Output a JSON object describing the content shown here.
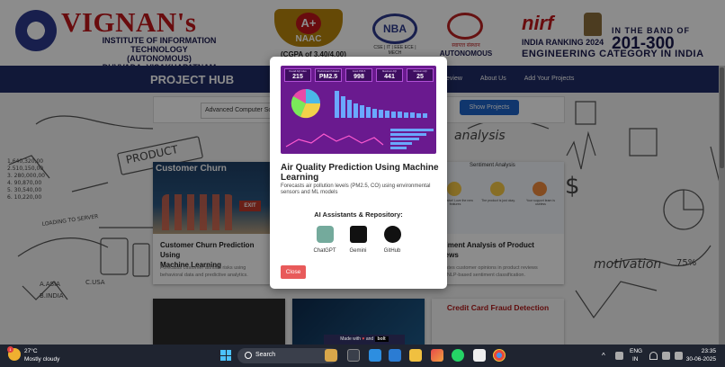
{
  "banner": {
    "institute_name": "VIGNAN's",
    "institute_sub1": "INSTITUTE OF INFORMATION TECHNOLOGY",
    "institute_sub2": "(AUTONOMOUS)",
    "institute_sub3": "DUVVADA, VISAKHAPATNAM",
    "naac_grade": "A+",
    "naac_label": "NAAC",
    "cgpa": "(CGPA of 3.40/4.00)",
    "nba_label": "NBA",
    "nba_sub": "CSE | IT | EEE ECE | MECH",
    "ugc_sub": "स्वायत्त संस्थान",
    "autonomous": "AUTONOMOUS",
    "nirf": "nirf",
    "ranking": "INDIA RANKING 2024",
    "band": "IN THE BAND OF",
    "band_range": "201-300",
    "category": "ENGINEERING CATEGORY IN INDIA"
  },
  "nav": {
    "brand": "PROJECT HUB",
    "links": [
      "eview",
      "About Us",
      "Add Your Projects"
    ]
  },
  "filter": {
    "select_value": "Advanced Computer Scie",
    "show_button": "Show Projects"
  },
  "cards": {
    "churn": {
      "image_heading": "Customer Churn",
      "exit": "EXIT",
      "title_line1": "Customer Churn Prediction Using",
      "title_line2": "Machine Learning",
      "desc_line1": "Forecasts customer attrition risks using",
      "desc_line2": "behavioral data and predictive analytics."
    },
    "sentiment": {
      "image_heading": "Sentiment Analysis",
      "rev1": "Impressive! Love the new features",
      "rev2": "The product is just okay.",
      "rev3": "Your support team is useless",
      "title_line1": "ntiment Analysis of Product",
      "title_line2": "views",
      "desc_line1": "aluates customer opinions in product reviews",
      "desc_line2": "ing NLP-based sentiment classification."
    },
    "fraud": {
      "image_heading": "Credit Card Fraud Detection"
    }
  },
  "sketch": {
    "product": "PRODUCT",
    "loading": "LOADING TO SERVER",
    "analysis": "analysis",
    "motivation": "motivation",
    "percent": "75%",
    "asia": "A.ASIA",
    "usa": "C.USA",
    "india": "B.INDIA",
    "nums": [
      "1.640,320,00",
      "2.510,150,00",
      "3. 280,000,00",
      "4. 90,870,00",
      "5. 30,540,00",
      "6. 10,220,00"
    ]
  },
  "modal": {
    "kpis": [
      {
        "label": "Overall AQI index",
        "value": "215"
      },
      {
        "label": "Predominant Pollutant",
        "value": "PM2.5"
      },
      {
        "label": "Count PM2.5",
        "value": "998"
      },
      {
        "label": "Maximum AQI",
        "value": "441"
      },
      {
        "label": "Minimum AQI",
        "value": "25"
      }
    ],
    "title": "Air Quality Prediction Using Machine Learning",
    "description": "Forecasts air pollution levels (PM2.5, CO) using environmental sensors and ML models",
    "ai_heading": "AI Assistants & Repository:",
    "assistants": [
      {
        "name": "ChatGPT",
        "icon": "chatgpt-icon",
        "color": "#74aa9c"
      },
      {
        "name": "Gemini",
        "icon": "gemini-icon",
        "color": "#111111"
      },
      {
        "name": "GitHub",
        "icon": "github-icon",
        "color": "#111111"
      }
    ],
    "close_label": "Close"
  },
  "footer": {
    "made_with_prefix": "Made with",
    "made_with_and": "and",
    "made_with_bolt": "bolt"
  },
  "taskbar": {
    "weather_badge": "1",
    "temperature": "27°C",
    "condition": "Mostly cloudy",
    "search_label": "Search",
    "lang1": "ENG",
    "lang2": "IN",
    "time": "23:35",
    "date": "30-06-2025"
  },
  "colors": {
    "accent": "#1e63c6",
    "nav": "#1f2c66",
    "close": "#e85a5a",
    "dashboard": "#6a1a8f",
    "brand_red": "#c0171b"
  }
}
